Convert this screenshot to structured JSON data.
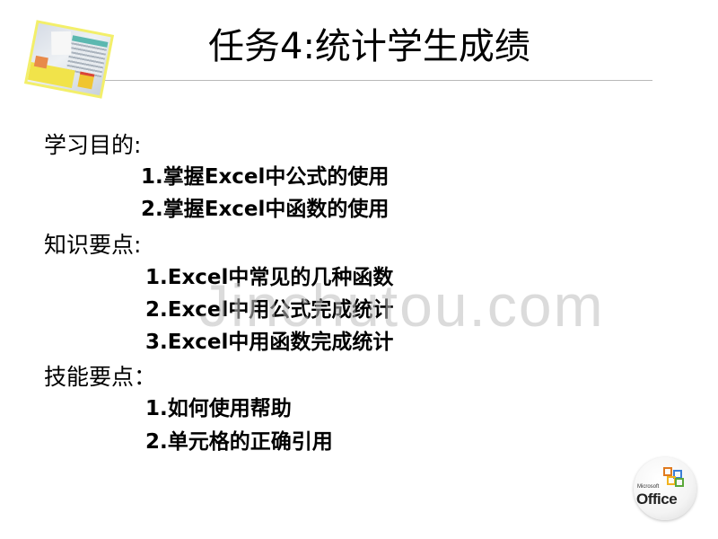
{
  "slide": {
    "title": "任务4:统计学生成绩",
    "sections": [
      {
        "heading": "学习目的:",
        "items": [
          "1.掌握Excel中公式的使用",
          "2.掌握Excel中函数的使用"
        ]
      },
      {
        "heading": "知识要点:",
        "items": [
          "1.Excel中常见的几种函数",
          "2.Excel中用公式完成统计",
          "3.Excel中用函数完成统计"
        ]
      },
      {
        "heading": "技能要点：",
        "items": [
          "1.如何使用帮助",
          "2.单元格的正确引用"
        ]
      }
    ],
    "watermark": "Jinchutou.com",
    "logo": {
      "brand_small": "Microsoft",
      "brand_large": "Office",
      "icon": "office-logo-icon"
    },
    "decor_image_icon": "office-desk-photo-icon"
  },
  "colors": {
    "photo_frame": "#f3ef6a",
    "rule": "#b8b8b8",
    "text": "#000000"
  }
}
